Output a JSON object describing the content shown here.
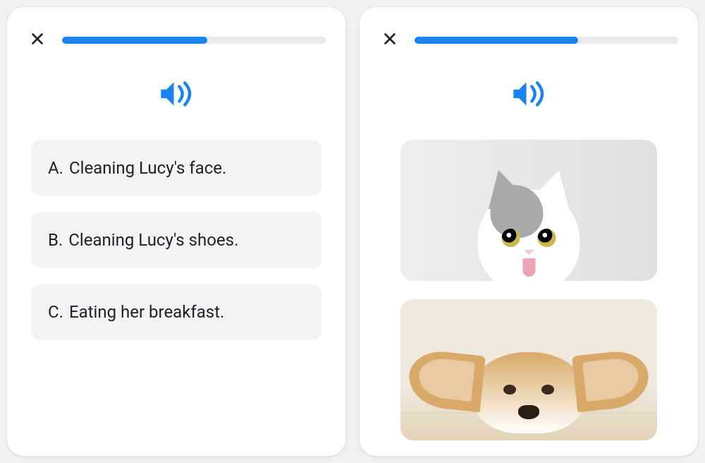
{
  "colors": {
    "accent": "#1a83f3",
    "option_bg": "#f1f3f4"
  },
  "card_a": {
    "progress_percent": 55,
    "options": [
      {
        "prefix": "A.",
        "text": "Cleaning Lucy's face."
      },
      {
        "prefix": "B.",
        "text": "Cleaning Lucy's shoes."
      },
      {
        "prefix": "C.",
        "text": "Eating her breakfast."
      }
    ]
  },
  "card_b": {
    "progress_percent": 62,
    "image_options": [
      {
        "name": "cat"
      },
      {
        "name": "dog"
      }
    ]
  }
}
